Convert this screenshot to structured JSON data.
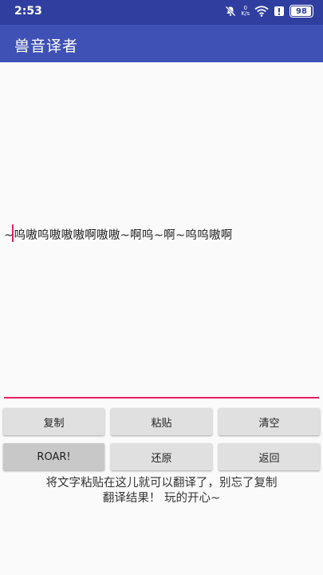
{
  "status_bar": {
    "time": "2:53",
    "speed_value": "0",
    "speed_unit": "K/s",
    "battery_level": "98",
    "icons": [
      "notifications-off-icon",
      "network-speed",
      "wifi-icon",
      "alert-icon",
      "battery-icon"
    ]
  },
  "app": {
    "title": "兽音译者"
  },
  "editor": {
    "text": "~呜嗷呜嗷嗷嗷啊嗷嗷~啊呜~啊~呜呜嗷啊"
  },
  "buttons": {
    "copy": "复制",
    "paste": "粘贴",
    "clear": "清空",
    "roar": "ROAR!",
    "restore": "还原",
    "back": "返回"
  },
  "hint": {
    "line1": "将文字粘贴在这儿就可以翻译了，别忘了复制",
    "line2": "翻译结果！ 玩的开心~"
  },
  "colors": {
    "status_bar": "#303f9f",
    "app_bar": "#3f51b5",
    "accent": "#e91e63",
    "button": "#e0e0e0",
    "button_pressed": "#c8c8c8"
  }
}
